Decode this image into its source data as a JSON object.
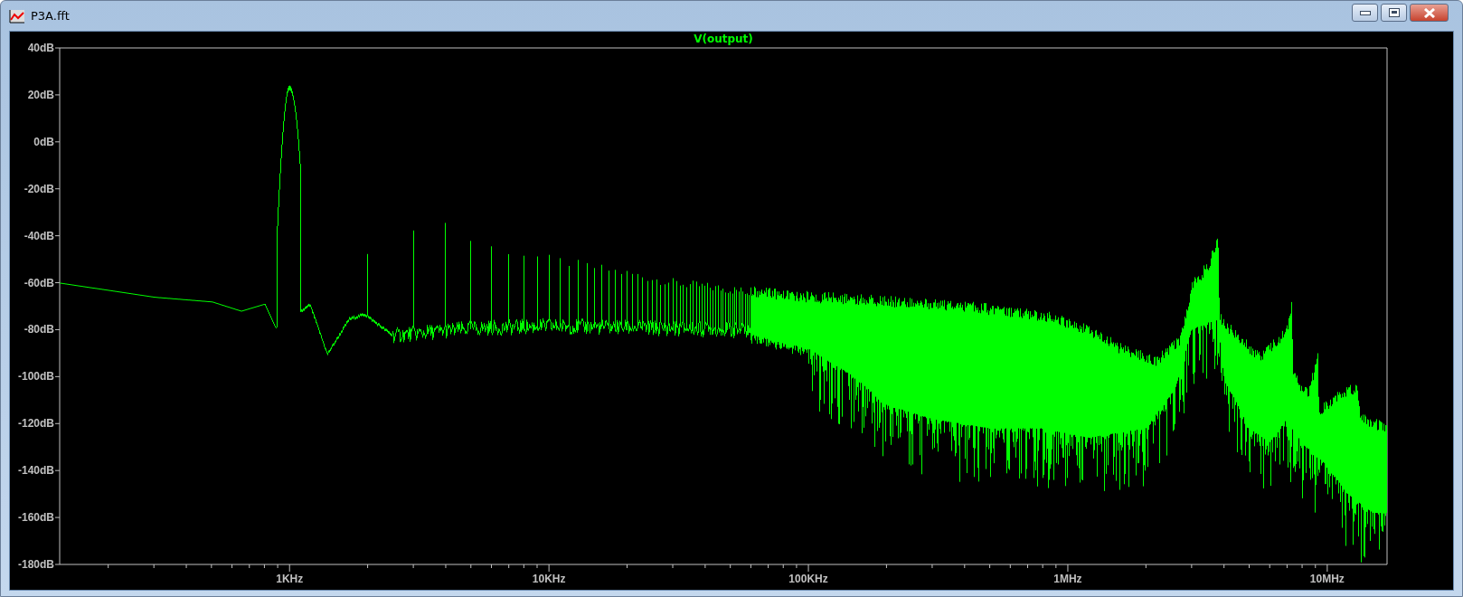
{
  "window": {
    "title": "P3A.fft",
    "buttons": [
      {
        "kind": "minimize"
      },
      {
        "kind": "maximize"
      },
      {
        "kind": "close"
      }
    ]
  },
  "plot": {
    "trace_label": "V(output)",
    "y_axis_labels": [
      "40dB",
      "20dB",
      "0dB",
      "-20dB",
      "-40dB",
      "-60dB",
      "-80dB",
      "-100dB",
      "-120dB",
      "-140dB",
      "-160dB",
      "-180dB"
    ],
    "x_axis_labels": [
      "1KHz",
      "10KHz",
      "100KHz",
      "1MHz",
      "10MHz"
    ]
  }
}
